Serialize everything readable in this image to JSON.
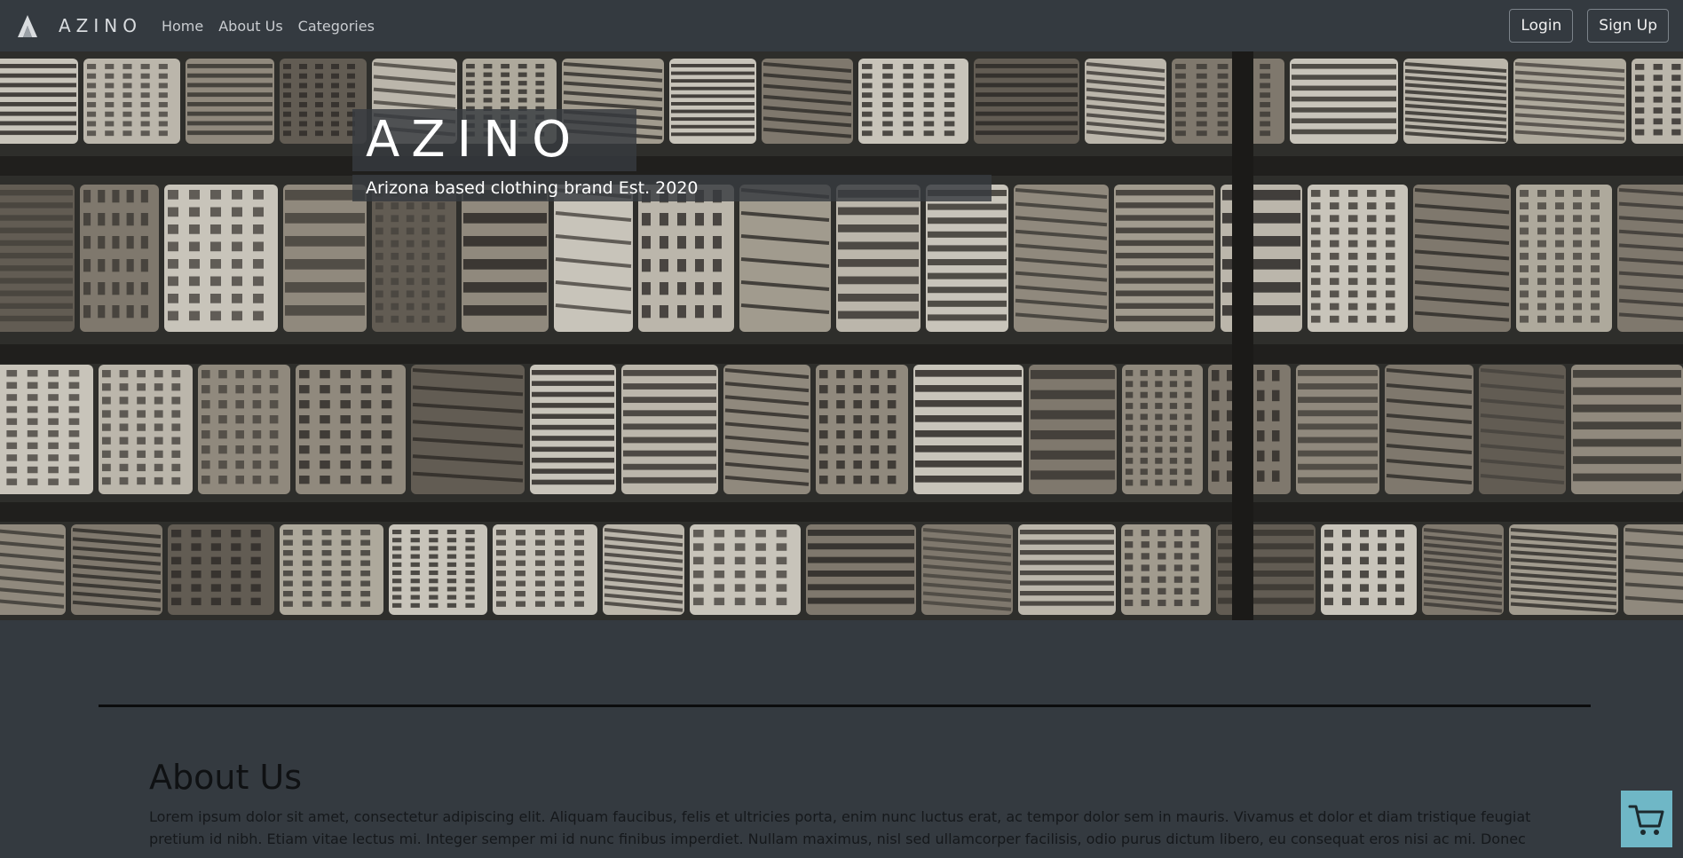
{
  "navbar": {
    "brand_name": "AZINO",
    "links": [
      "Home",
      "About Us",
      "Categories"
    ],
    "login_label": "Login",
    "signup_label": "Sign Up"
  },
  "hero": {
    "title": "AZINO",
    "subtitle": "Arizona based clothing brand Est. 2020"
  },
  "about": {
    "heading": "About Us",
    "text": "Lorem ipsum dolor sit amet, consectetur adipiscing elit. Aliquam faucibus, felis et ultricies porta, enim nunc luctus erat, ac tempor dolor sem in mauris. Vivamus et dolor et diam tristique feugiat pretium id nibh. Etiam vitae lectus mi. Integer semper mi id nunc finibus imperdiet. Nullam maximus, nisl sed ullamcorper facilisis, odio purus dictum libero, eu consequat eros nisi ac mi. Donec"
  },
  "icons": {
    "logo": "azino-a-logo-icon",
    "cart": "shopping-cart-icon"
  },
  "colors": {
    "background": "#343a40",
    "cart_button": "#6fb7c6"
  }
}
